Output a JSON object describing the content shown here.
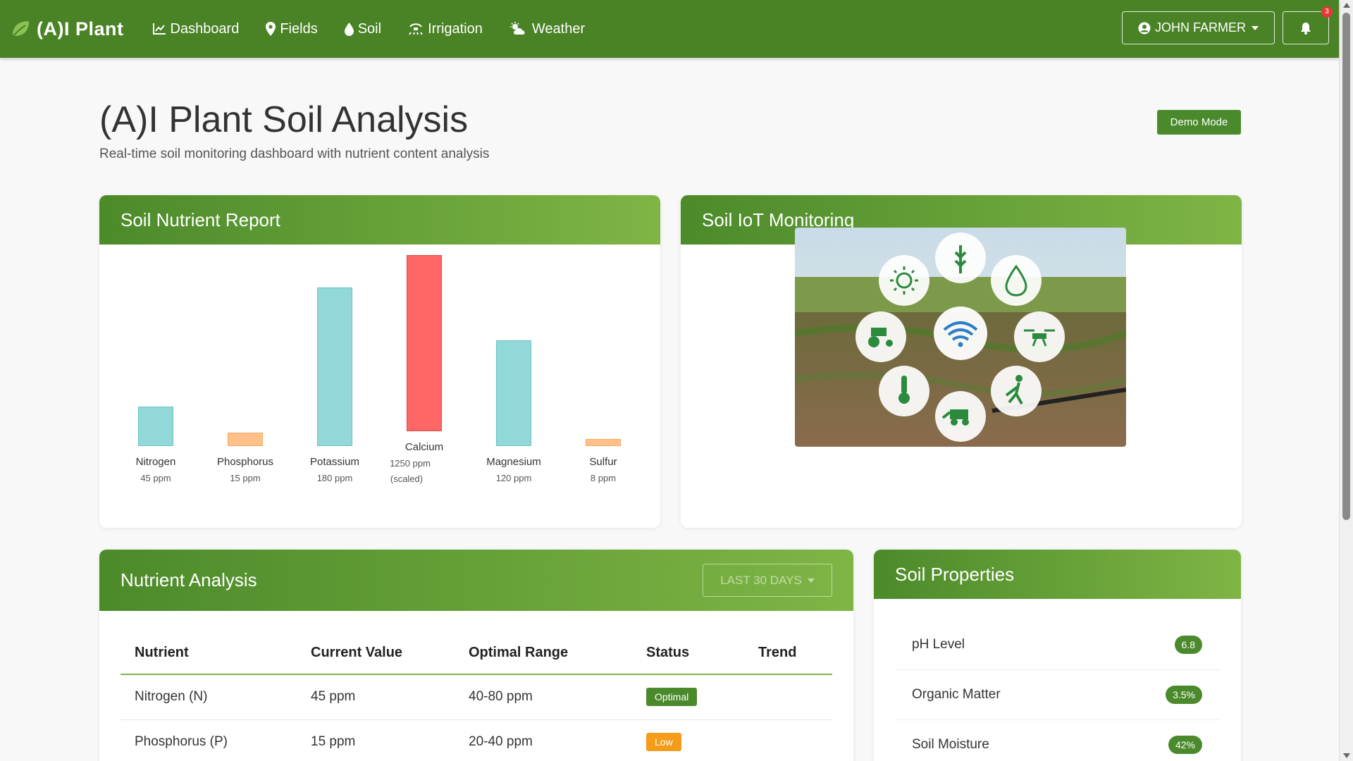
{
  "nav": {
    "brand": "(A)I Plant",
    "links": [
      {
        "label": "Dashboard",
        "icon": "chart-line-icon"
      },
      {
        "label": "Fields",
        "icon": "map-pin-icon"
      },
      {
        "label": "Soil",
        "icon": "water-drop-icon"
      },
      {
        "label": "Irrigation",
        "icon": "sprinkler-icon"
      },
      {
        "label": "Weather",
        "icon": "cloud-sun-icon"
      }
    ],
    "user": "JOHN FARMER",
    "notification_count": "3"
  },
  "header": {
    "title": "(A)I Plant Soil Analysis",
    "subtitle": "Real-time soil monitoring dashboard with nutrient content analysis",
    "demo_label": "Demo Mode"
  },
  "report": {
    "title": "Soil Nutrient Report"
  },
  "chart_data": {
    "type": "bar",
    "categories": [
      "Nitrogen",
      "Phosphorus",
      "Potassium",
      "Calcium",
      "Magnesium",
      "Sulfur"
    ],
    "values": [
      45,
      15,
      180,
      1250,
      120,
      8
    ],
    "value_labels": [
      "45 ppm",
      "15 ppm",
      "180 ppm",
      "1250 ppm",
      "120 ppm",
      "8 ppm"
    ],
    "notes": [
      "",
      "",
      "",
      "(scaled)",
      "",
      ""
    ],
    "colors": [
      "#93d8d8",
      "#ffc08a",
      "#93d8d8",
      "#ff6666",
      "#93d8d8",
      "#ffc08a"
    ],
    "scaled_display_values": [
      45,
      15,
      180,
      200,
      120,
      8
    ]
  },
  "iot": {
    "title": "Soil IoT Monitoring"
  },
  "analysis": {
    "title": "Nutrient Analysis",
    "range_label": "LAST 30 DAYS",
    "columns": [
      "Nutrient",
      "Current Value",
      "Optimal Range",
      "Status",
      "Trend"
    ],
    "rows": [
      {
        "nutrient": "Nitrogen (N)",
        "value": "45 ppm",
        "range": "40-80 ppm",
        "status": "Optimal",
        "status_color": "#4a8a2c"
      },
      {
        "nutrient": "Phosphorus (P)",
        "value": "15 ppm",
        "range": "20-40 ppm",
        "status": "Low",
        "status_color": "#f59c1a"
      }
    ]
  },
  "properties": {
    "title": "Soil Properties",
    "items": [
      {
        "label": "pH Level",
        "value": "6.8"
      },
      {
        "label": "Organic Matter",
        "value": "3.5%"
      },
      {
        "label": "Soil Moisture",
        "value": "42%"
      }
    ]
  }
}
